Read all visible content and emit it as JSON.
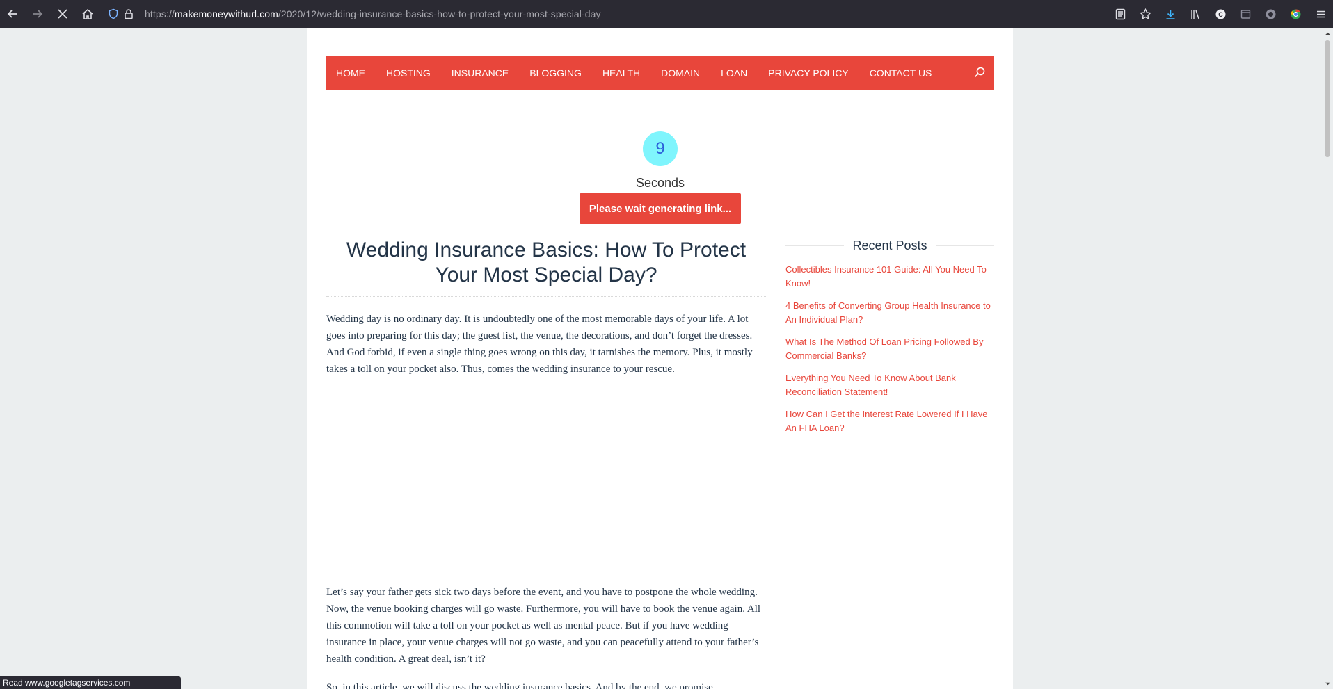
{
  "browser": {
    "url_prefix": "https://",
    "url_host": "makemoneywithurl.com",
    "url_path": "/2020/12/wedding-insurance-basics-how-to-protect-your-most-special-day",
    "status_text": "Read www.googletagservices.com"
  },
  "nav": {
    "items": [
      "HOME",
      "HOSTING",
      "INSURANCE",
      "BLOGGING",
      "HEALTH",
      "DOMAIN",
      "LOAN",
      "PRIVACY POLICY",
      "CONTACT US"
    ]
  },
  "timer": {
    "count": "9",
    "label": "Seconds",
    "button_label": "Please wait generating link..."
  },
  "post": {
    "title": "Wedding Insurance Basics: How To Protect Your Most Special Day?",
    "paragraphs": [
      "Wedding day is no ordinary day. It is undoubtedly one of the most memorable days of your life. A lot goes into preparing for this day; the guest list, the venue, the decorations, and don’t forget the dresses. And God forbid, if even a single thing goes wrong on this day, it tarnishes the memory. Plus, it mostly takes a toll on your pocket also. Thus, comes the wedding insurance to your rescue.",
      "Let’s say your father gets sick two days before the event, and you have to postpone the whole wedding. Now, the venue booking charges will go waste. Furthermore, you will have to book the venue again. All this commotion will take a toll on your pocket as well as mental peace. But if you have wedding insurance in place, your venue charges will not go waste, and you can peacefully attend to your father’s health condition. A great deal, isn’t it?",
      "So, in this article, we will discuss the wedding insurance basics. And by the end, we promise,"
    ]
  },
  "sidebar": {
    "title": "Recent Posts",
    "posts": [
      "Collectibles Insurance 101 Guide: All You Need To Know!",
      "4 Benefits of Converting Group Health Insurance to An Individual Plan?",
      "What Is The Method Of Loan Pricing Followed By Commercial Banks?",
      "Everything You Need To Know About Bank Reconciliation Statement!",
      "How Can I Get the Interest Rate Lowered If I Have An FHA Loan?"
    ]
  },
  "colors": {
    "accent": "#e8463b",
    "timer_bg": "#7ff5fd",
    "timer_text": "#2b5fd9",
    "heading": "#233447",
    "browser_chrome": "#2b2a33"
  }
}
